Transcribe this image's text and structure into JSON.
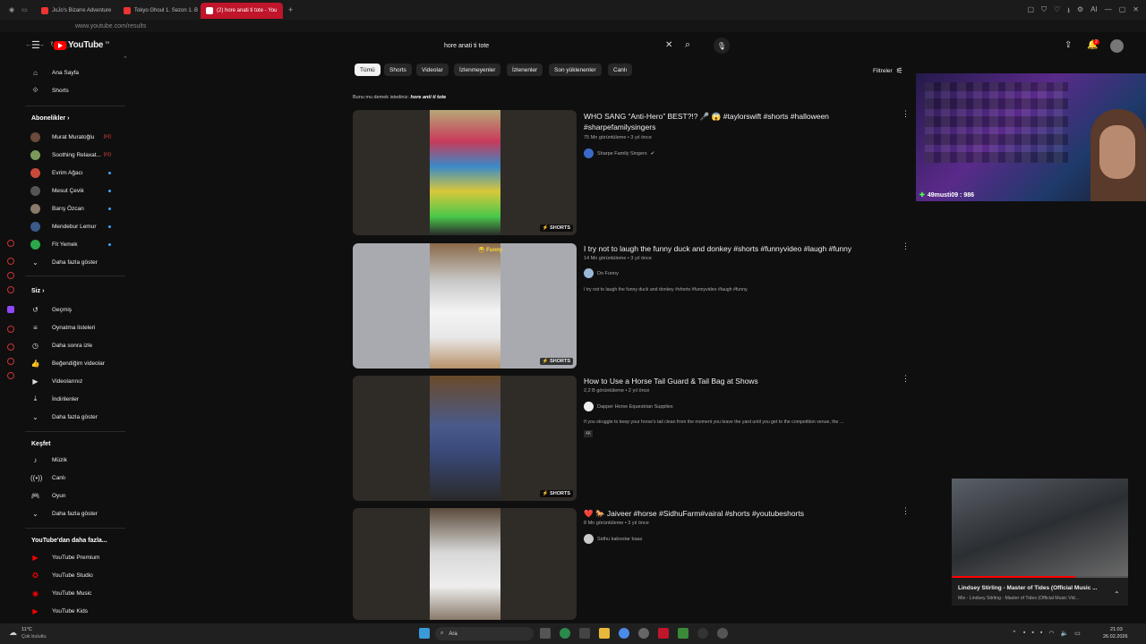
{
  "browser": {
    "tabs": [
      {
        "label": "JoJo's Bizarre Adventure"
      },
      {
        "label": "Tokyo Ghoul 1. Sezon 1. B"
      },
      {
        "label": "(2) hore anati ti tote - You"
      }
    ],
    "new_tab": "+",
    "url": "www.youtube.com/results",
    "profile": "AI"
  },
  "header": {
    "logo_text": "YouTube",
    "logo_region": "TR",
    "search_value": "hore anati ti tote",
    "notif_count": "2"
  },
  "sidebar": {
    "main": [
      {
        "label": "Ana Sayfa"
      },
      {
        "label": "Shorts"
      }
    ],
    "subs_heading": "Abonelikler",
    "subs": [
      {
        "label": "Murat Muratoğlu",
        "color": "#6a4a3a"
      },
      {
        "label": "Soothing Relaxat...",
        "color": "#7a9a5a"
      },
      {
        "label": "Evrim Ağacı",
        "color": "#c84a3a"
      },
      {
        "label": "Mesut Çevik",
        "color": "#555555"
      },
      {
        "label": "Barış Özcan",
        "color": "#8a7a6a"
      },
      {
        "label": "Mendebur Lemur",
        "color": "#3a5a8a"
      },
      {
        "label": "Fit Yemek",
        "color": "#2aa84a"
      }
    ],
    "subs_more": "Daha fazla göster",
    "you_heading": "Siz",
    "you": [
      {
        "label": "Geçmiş"
      },
      {
        "label": "Oynatma listeleri"
      },
      {
        "label": "Daha sonra izle"
      },
      {
        "label": "Beğendiğim videolar"
      },
      {
        "label": "Videolarınız"
      },
      {
        "label": "İndirilenler"
      }
    ],
    "you_more": "Daha fazla göster",
    "explore_heading": "Keşfet",
    "explore": [
      {
        "label": "Müzik"
      },
      {
        "label": "Canlı"
      },
      {
        "label": "Oyun"
      }
    ],
    "explore_more": "Daha fazla göster",
    "more_heading": "YouTube'dan daha fazla...",
    "more": [
      {
        "label": "YouTube Premium"
      },
      {
        "label": "YouTube Studio"
      },
      {
        "label": "YouTube Music"
      },
      {
        "label": "YouTube Kids"
      }
    ]
  },
  "chips": [
    "Tümü",
    "Shorts",
    "Videolar",
    "İzlenmeyenler",
    "İzlenenler",
    "Son yüklenenler",
    "Canlı"
  ],
  "filters_label": "Filtreler",
  "did_you_mean": {
    "prefix": "Bunu mu demek istediniz:",
    "suggestion": "hore anti ti tote"
  },
  "results": [
    {
      "title": "WHO SANG “Anti-Hero” BEST?!? 🎤 😱 #taylorswift #shorts #halloween #sharpefamilysingers",
      "meta": "75 Mn görüntüleme • 3 yıl önce",
      "channel": "Sharpe Family Singers",
      "verified": "✔",
      "desc": "",
      "badge": "SHORTS",
      "extra": ""
    },
    {
      "title": "I try not to laugh the funny duck and donkey #shorts #funnyvideo #laugh #funny",
      "meta": "14 Mn görüntüleme • 3 yıl önce",
      "channel": "Do Funny",
      "verified": "",
      "desc": "I try not to laugh the funny duck and donkey #shorts #funnyvideo #laugh #funny.",
      "badge": "SHORTS",
      "extra": "",
      "thumb_label": "Funny"
    },
    {
      "title": "How to Use a Horse Tail Guard & Tail Bag at Shows",
      "meta": "2,2 B görüntüleme • 2 yıl önce",
      "channel": "Dapper Horse Equestrian Supplies",
      "verified": "",
      "desc": "If you struggle to keep your horse's tail clean from the moment you leave the yard until you get to the competition venue, the ...",
      "badge": "SHORTS",
      "extra": "4K"
    },
    {
      "title": "❤️ 🐎 Jaiveer #horse #SidhuFarm#vairal #shorts #youtubeshorts",
      "meta": "8 Mn görüntüleme • 3 yıl önce",
      "channel": "Sidhu kabootar baaz",
      "verified": "",
      "desc": "",
      "badge": "",
      "extra": ""
    }
  ],
  "webcam": {
    "caption": "49musti09 : 986",
    "plus": "✚"
  },
  "miniplayer": {
    "title": "Lindsey Stirling - Master of Tides (Official Music ...",
    "subtitle": "Mix - Lindsey Stirling - Master of Tides (Official Music Vid...",
    "progress": 0.7
  },
  "taskbar": {
    "weather_temp": "11°C",
    "weather_text": "Çok bulutlu",
    "search": "Ara",
    "time": "21:03",
    "date": "26.02.2026"
  },
  "colors": {
    "accent": "#ff0000",
    "tab_active": "#c0152a",
    "link": "#3ea6ff"
  }
}
